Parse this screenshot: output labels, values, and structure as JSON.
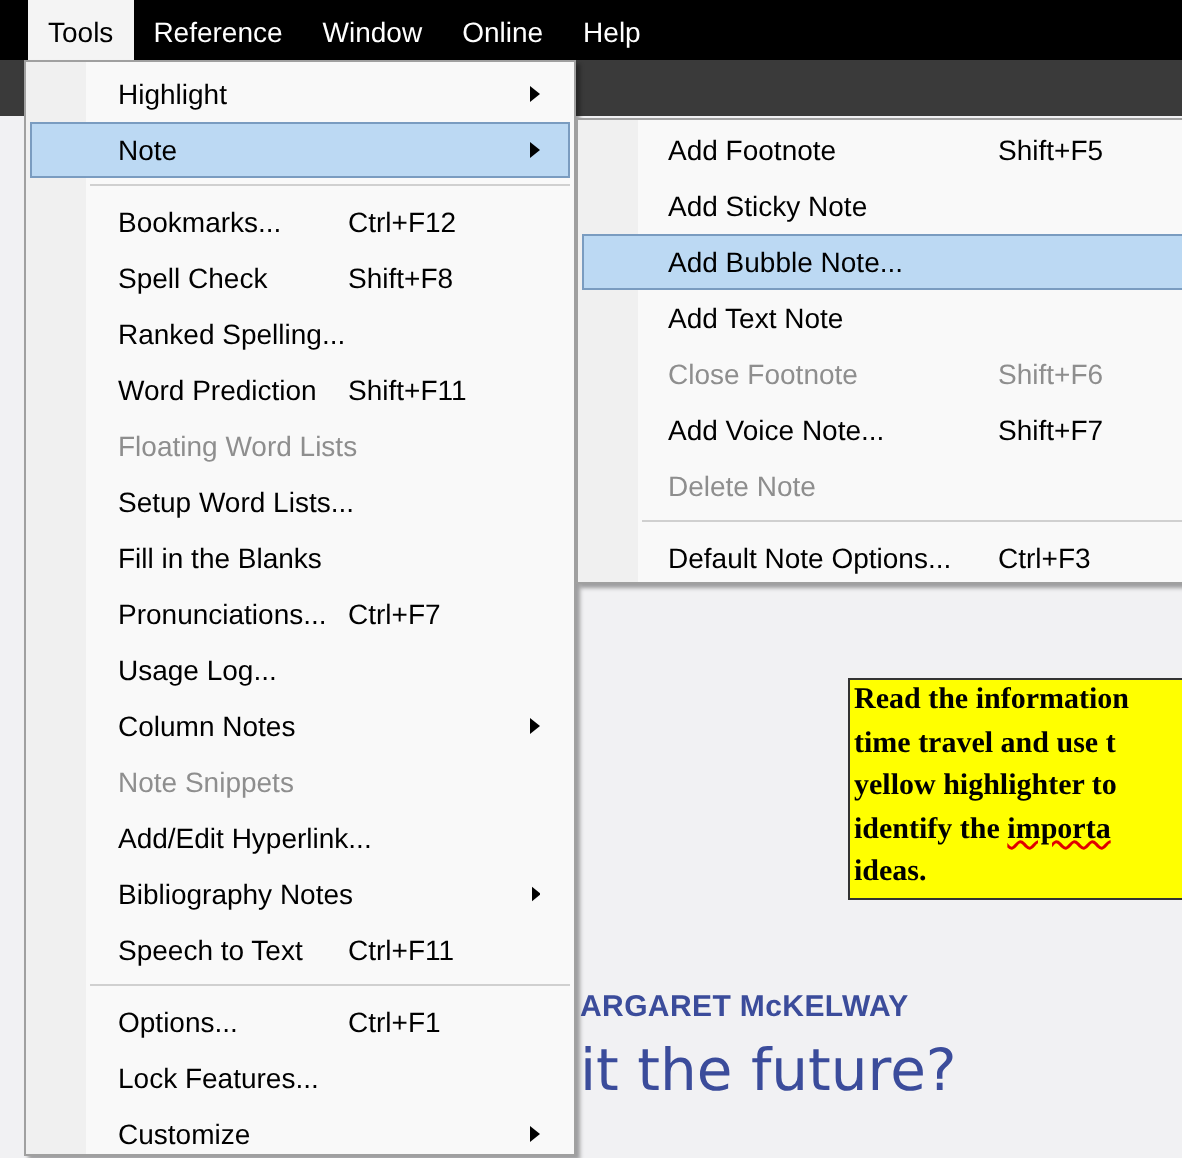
{
  "menubar": [
    {
      "label": "Tools",
      "selected": true
    },
    {
      "label": "Reference",
      "selected": false
    },
    {
      "label": "Window",
      "selected": false
    },
    {
      "label": "Online",
      "selected": false
    },
    {
      "label": "Help",
      "selected": false
    }
  ],
  "tools_menu": [
    {
      "kind": "item",
      "label": "Highlight",
      "submenu": true,
      "disabled": false,
      "selected": false
    },
    {
      "kind": "item",
      "label": "Note",
      "submenu": true,
      "disabled": false,
      "selected": true
    },
    {
      "kind": "separator"
    },
    {
      "kind": "item",
      "label": "Bookmarks...",
      "shortcut": "Ctrl+F12",
      "submenu": false,
      "disabled": false,
      "selected": false
    },
    {
      "kind": "item",
      "label": "Spell Check",
      "shortcut": "Shift+F8",
      "submenu": false,
      "disabled": false,
      "selected": false
    },
    {
      "kind": "item",
      "label": "Ranked Spelling...",
      "submenu": false,
      "disabled": false,
      "selected": false
    },
    {
      "kind": "item",
      "label": "Word Prediction",
      "shortcut": "Shift+F11",
      "submenu": false,
      "disabled": false,
      "selected": false
    },
    {
      "kind": "item",
      "label": "Floating Word Lists",
      "submenu": false,
      "disabled": true,
      "selected": false
    },
    {
      "kind": "item",
      "label": "Setup Word Lists...",
      "submenu": false,
      "disabled": false,
      "selected": false
    },
    {
      "kind": "item",
      "label": "Fill in the Blanks",
      "submenu": false,
      "disabled": false,
      "selected": false
    },
    {
      "kind": "item",
      "label": "Pronunciations...",
      "shortcut": "Ctrl+F7",
      "submenu": false,
      "disabled": false,
      "selected": false
    },
    {
      "kind": "item",
      "label": "Usage Log...",
      "submenu": false,
      "disabled": false,
      "selected": false
    },
    {
      "kind": "item",
      "label": "Column Notes",
      "submenu": true,
      "disabled": false,
      "selected": false
    },
    {
      "kind": "item",
      "label": "Note Snippets",
      "submenu": false,
      "disabled": true,
      "selected": false
    },
    {
      "kind": "item",
      "label": "Add/Edit Hyperlink...",
      "submenu": false,
      "disabled": false,
      "selected": false
    },
    {
      "kind": "item",
      "label": "Bibliography Notes",
      "submenu": true,
      "disabled": false,
      "selected": false
    },
    {
      "kind": "item",
      "label": "Speech to Text",
      "shortcut": "Ctrl+F11",
      "submenu": false,
      "disabled": false,
      "selected": false
    },
    {
      "kind": "separator"
    },
    {
      "kind": "item",
      "label": "Options...",
      "shortcut": "Ctrl+F1",
      "submenu": false,
      "disabled": false,
      "selected": false
    },
    {
      "kind": "item",
      "label": "Lock Features...",
      "submenu": false,
      "disabled": false,
      "selected": false
    },
    {
      "kind": "item",
      "label": "Customize",
      "submenu": true,
      "disabled": false,
      "selected": false
    }
  ],
  "note_submenu": [
    {
      "kind": "item",
      "label": "Add Footnote",
      "shortcut": "Shift+F5",
      "disabled": false,
      "selected": false
    },
    {
      "kind": "item",
      "label": "Add Sticky Note",
      "disabled": false,
      "selected": false
    },
    {
      "kind": "item",
      "label": "Add Bubble Note...",
      "disabled": false,
      "selected": true
    },
    {
      "kind": "item",
      "label": "Add Text Note",
      "disabled": false,
      "selected": false
    },
    {
      "kind": "item",
      "label": "Close Footnote",
      "shortcut": "Shift+F6",
      "disabled": true,
      "selected": false
    },
    {
      "kind": "item",
      "label": "Add Voice Note...",
      "shortcut": "Shift+F7",
      "disabled": false,
      "selected": false
    },
    {
      "kind": "item",
      "label": "Delete Note",
      "disabled": true,
      "selected": false
    },
    {
      "kind": "separator"
    },
    {
      "kind": "item",
      "label": "Default Note Options...",
      "shortcut": "Ctrl+F3",
      "disabled": false,
      "selected": false
    }
  ],
  "document": {
    "sticky_note": [
      {
        "text": "Read the information"
      },
      {
        "text": "time travel and use t"
      },
      {
        "text": "yellow highlighter to"
      },
      {
        "text": "identify the ",
        "misspelled": "importa"
      },
      {
        "text": "ideas."
      }
    ],
    "author": "ARGARET McKELWAY",
    "title": "it the future?"
  }
}
